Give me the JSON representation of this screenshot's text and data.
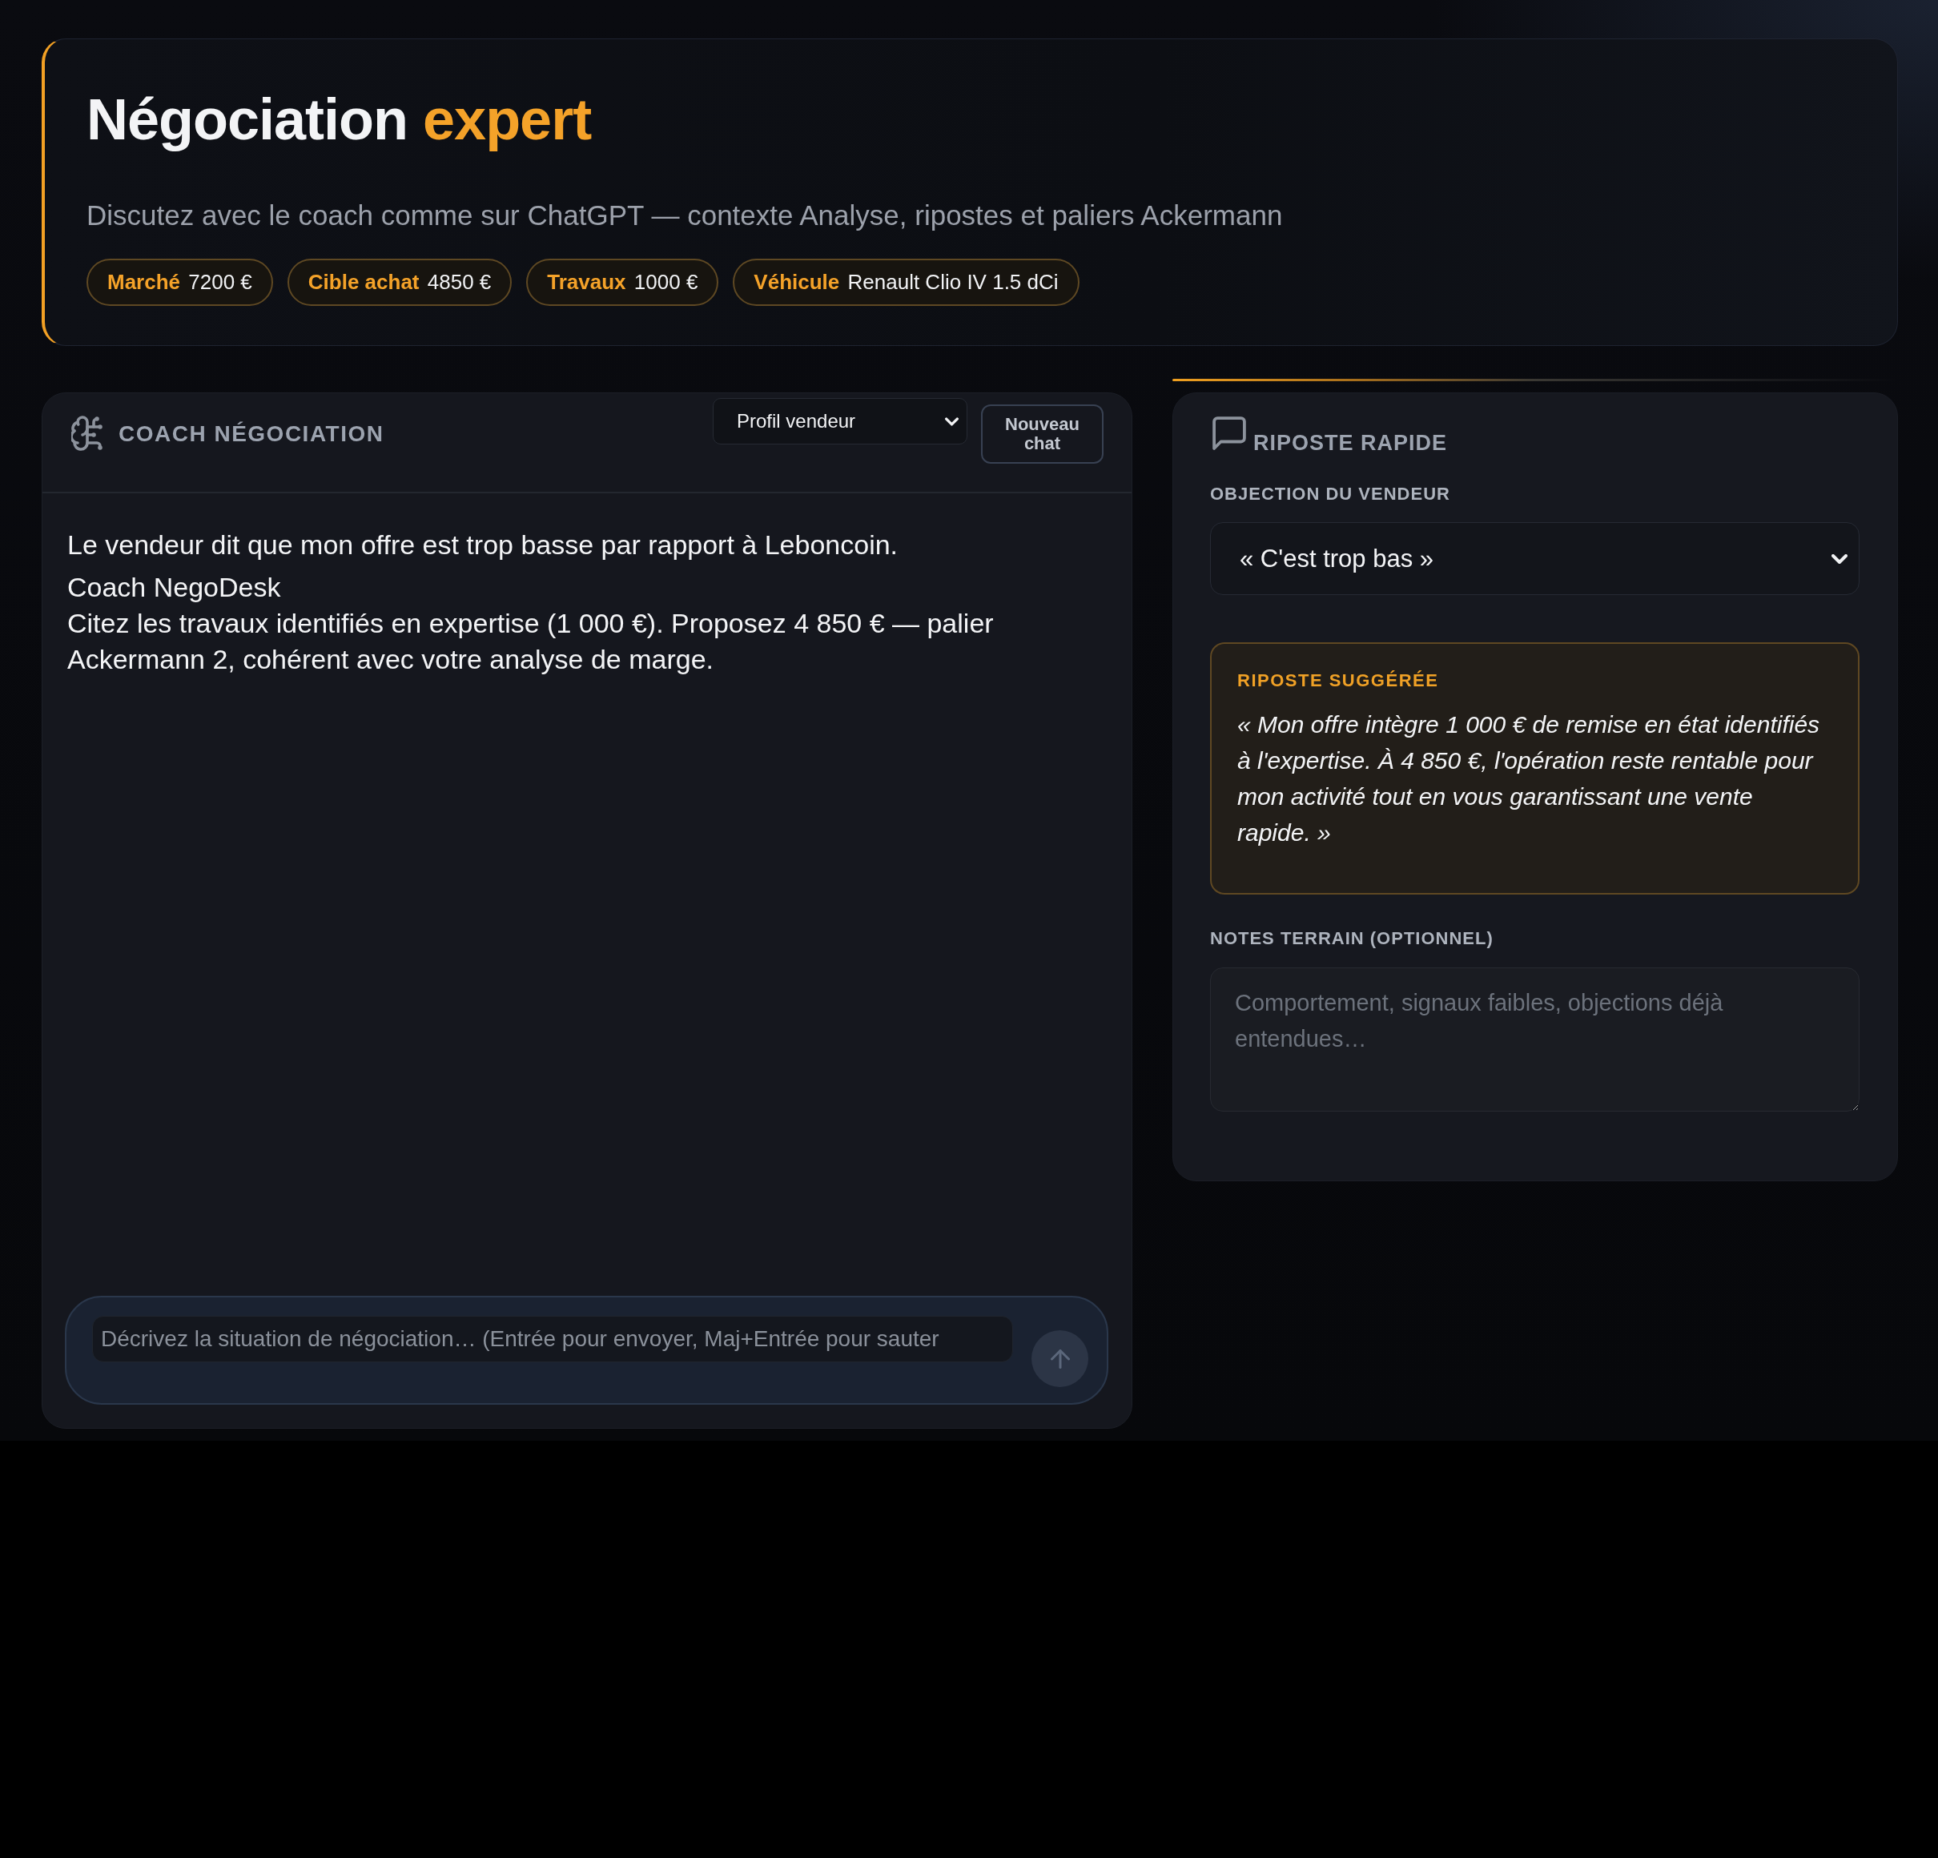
{
  "header": {
    "title": "Négociation",
    "title_highlight": "expert",
    "subtitle": "Discutez avec le coach comme sur ChatGPT — contexte Analyse, ripostes et paliers Ackermann",
    "chips": [
      {
        "label": "Marché",
        "value": "7200 €"
      },
      {
        "label": "Cible achat",
        "value": "4850 €"
      },
      {
        "label": "Travaux",
        "value": "1000 €"
      },
      {
        "label": "Véhicule",
        "value": "Renault Clio IV 1.5 dCi"
      }
    ]
  },
  "coach_panel": {
    "title": "COACH NÉGOCIATION",
    "profile_select": {
      "value": "Profil vendeur"
    },
    "new_chat_button": "Nouveau chat",
    "messages": [
      {
        "kind": "user",
        "text": "Le vendeur dit que mon offre est trop basse par rapport à Leboncoin."
      },
      {
        "kind": "assistant",
        "author": "Coach NegoDesk",
        "text": "Citez les travaux identifiés en expertise (1 000 €). Proposez 4 850 € — palier Ackermann 2, cohérent avec votre analyse de marge."
      }
    ],
    "composer": {
      "placeholder": "Décrivez la situation de négociation… (Entrée pour envoyer, Maj+Entrée pour sauter",
      "send_button": {
        "disabled": true
      }
    }
  },
  "riposte_panel": {
    "title": "RIPOSTE RAPIDE",
    "objection": {
      "label": "OBJECTION DU VENDEUR",
      "value": "« C'est trop bas »"
    },
    "suggestion": {
      "heading": "RIPOSTE SUGGÉRÉE",
      "text": "« Mon offre intègre 1 000 € de remise en état identifiés à l'expertise. À 4 850 €, l'opération reste rentable pour mon activité tout en vous garantissant une vente rapide. »"
    },
    "notes": {
      "label": "NOTES TERRAIN (OPTIONNEL)",
      "placeholder": "Comportement, signaux faibles, objections déjà entendues…"
    }
  }
}
